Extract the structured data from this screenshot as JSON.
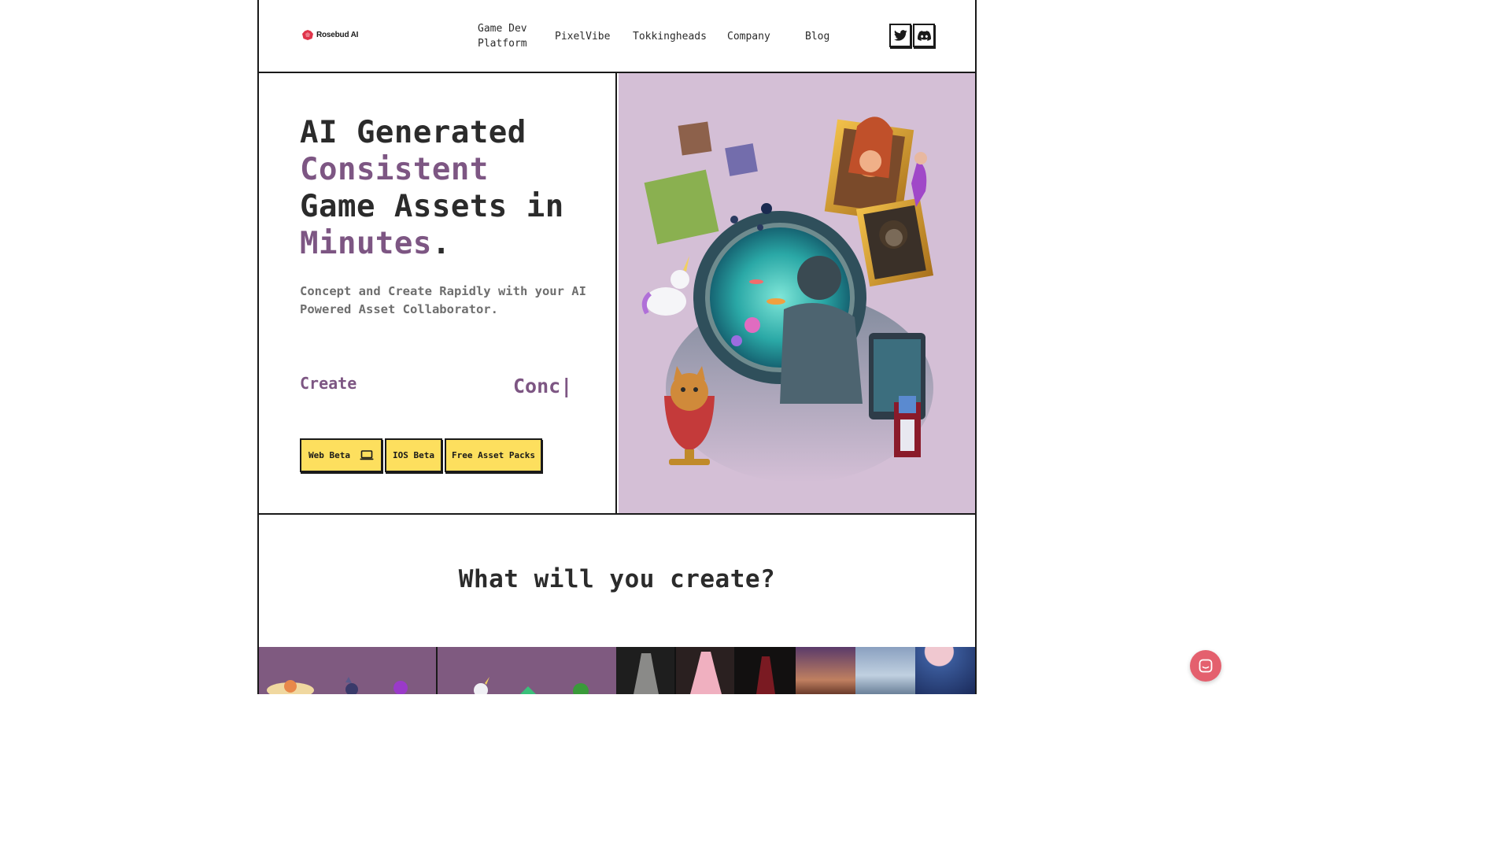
{
  "brand": {
    "name": "Rosebud AI",
    "logo_color": "#e0344a"
  },
  "nav": {
    "items": [
      "Game Dev Platform",
      "PixelVibe",
      "Tokkingheads",
      "Company",
      "Blog"
    ],
    "social": [
      {
        "name": "twitter-icon"
      },
      {
        "name": "discord-icon"
      }
    ]
  },
  "hero": {
    "headline": {
      "line1": "AI Generated",
      "line2": "Consistent",
      "line3": "Game Assets in",
      "line4": "Minutes",
      "period": "."
    },
    "subtitle": "Concept and Create Rapidly with your AI Powered Asset Collaborator.",
    "typer_left": "Create",
    "typer_right": "Conc|",
    "buttons": {
      "web_beta": "Web Beta",
      "ios_beta": "IOS Beta",
      "free_asset_packs": "Free Asset Packs"
    }
  },
  "section": {
    "title": "What will you create?"
  },
  "colors": {
    "accent": "#7d5683",
    "cta": "#fddf5e",
    "hero_bg": "#d4bfd6",
    "tile_purple": "#7f5a80",
    "chat": "#e4606e"
  },
  "icons": [
    "laptop-icon",
    "chat-icon"
  ]
}
